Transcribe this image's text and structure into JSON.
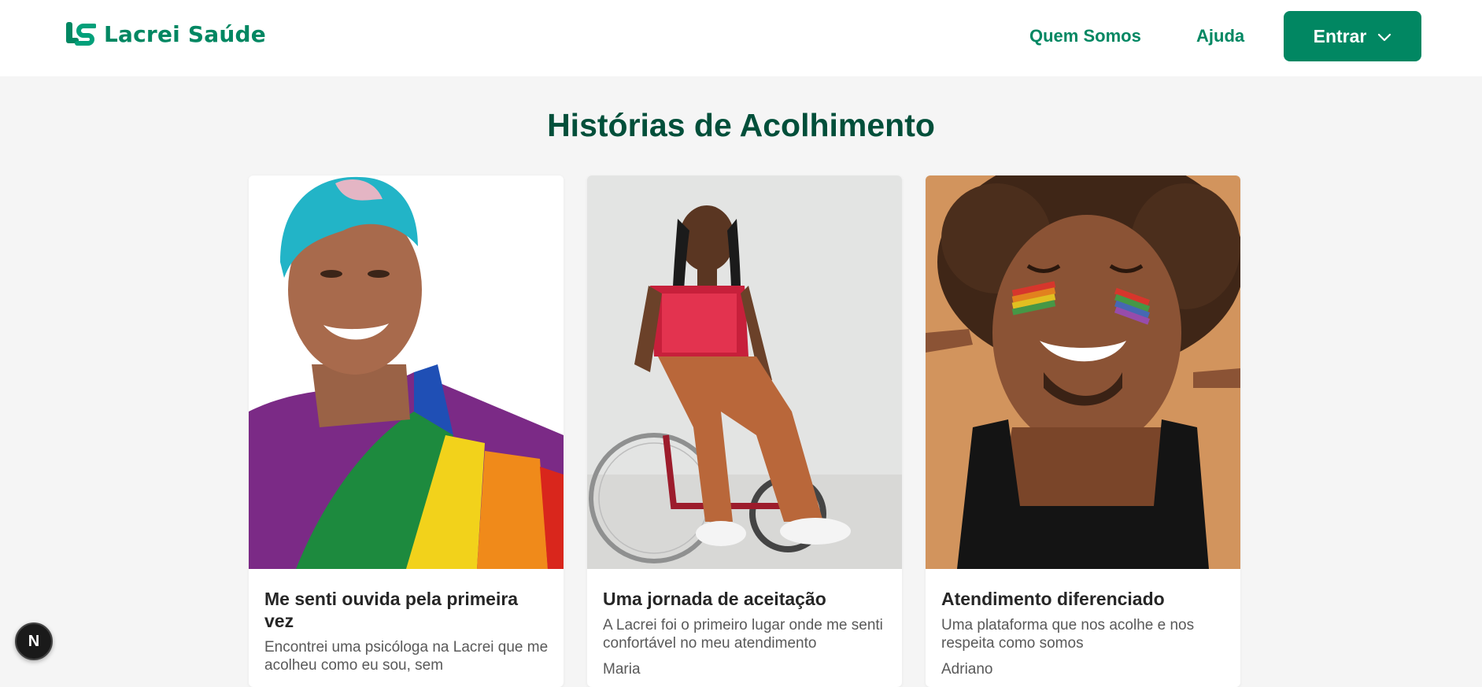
{
  "header": {
    "logo_text": "Lacrei Saúde",
    "nav": [
      {
        "label": "Quem Somos"
      },
      {
        "label": "Ajuda"
      }
    ],
    "login_button": {
      "label": "Entrar",
      "icon": "chevron-down-icon"
    }
  },
  "main": {
    "title": "Histórias de Acolhimento",
    "cards": [
      {
        "title": "Me senti ouvida pela primeira vez",
        "description": "Encontrei uma psicóloga na Lacrei que me acolheu como eu sou, sem",
        "author": ""
      },
      {
        "title": "Uma jornada de aceitação",
        "description": "A Lacrei foi o primeiro lugar onde me senti confortável no meu atendimento",
        "author": "Maria"
      },
      {
        "title": "Atendimento diferenciado",
        "description": "Uma plataforma que nos acolhe e nos respeita como somos",
        "author": "Adriano"
      }
    ]
  },
  "dev_badge": {
    "label": "N"
  },
  "colors": {
    "brand": "#018762",
    "title": "#014f3a",
    "page_bg": "#f5f5f5"
  }
}
